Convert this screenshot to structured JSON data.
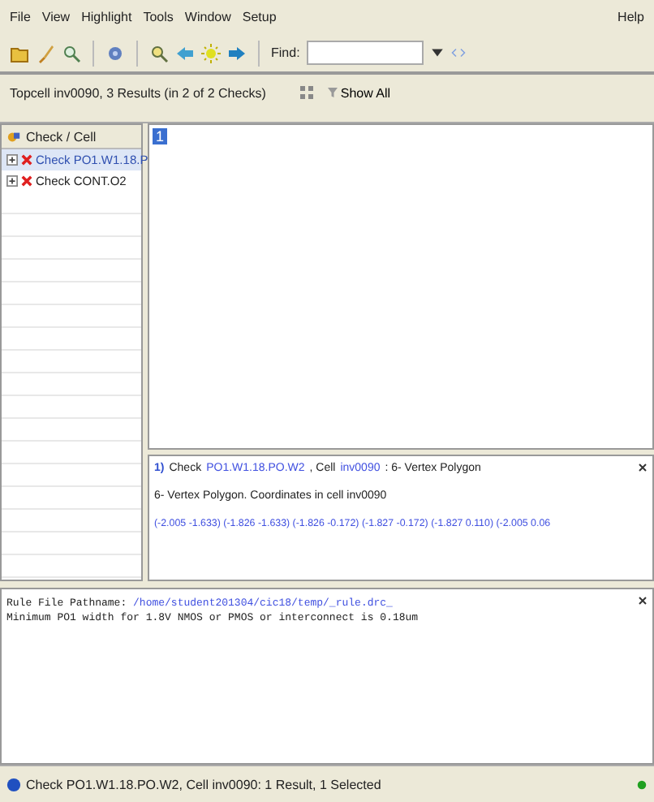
{
  "menu": {
    "items": [
      "File",
      "View",
      "Highlight",
      "Tools",
      "Window",
      "Setup"
    ],
    "help": "Help"
  },
  "toolbar": {
    "find_label": "Find:"
  },
  "info_bar": {
    "summary": "Topcell inv0090, 3 Results (in 2 of 2 Checks)",
    "show_all": "Show All"
  },
  "tree": {
    "header": "Check / Cell",
    "items": [
      {
        "label": "Check PO1.W1.18.P",
        "selected": true
      },
      {
        "label": "Check CONT.O2",
        "selected": false
      }
    ]
  },
  "results": [
    {
      "index": "1",
      "selected": true
    }
  ],
  "detail": {
    "title": [
      {
        "kind": "index",
        "text": "1)"
      },
      {
        "kind": "plain",
        "text": "Check"
      },
      {
        "kind": "link",
        "text": "PO1.W1.18.PO.W2"
      },
      {
        "kind": "plain",
        "text": ", Cell"
      },
      {
        "kind": "link",
        "text": "inv0090"
      },
      {
        "kind": "plain",
        "text": ": 6- Vertex Polygon"
      }
    ],
    "description": "6- Vertex Polygon. Coordinates in cell inv0090",
    "coordinates": "(-2.005 -1.633)  (-1.826 -1.633)  (-1.826 -0.172)  (-1.827 -0.172)  (-1.827  0.110)  (-2.005  0.06"
  },
  "rule": {
    "label": "Rule File Pathname:",
    "path": "/home/student201304/cic18/temp/_rule.drc_",
    "message": "Minimum PO1 width for 1.8V NMOS or PMOS or interconnect is 0.18um"
  },
  "status_bar": {
    "text": "Check PO1.W1.18.PO.W2, Cell inv0090: 1 Result, 1 Selected"
  }
}
